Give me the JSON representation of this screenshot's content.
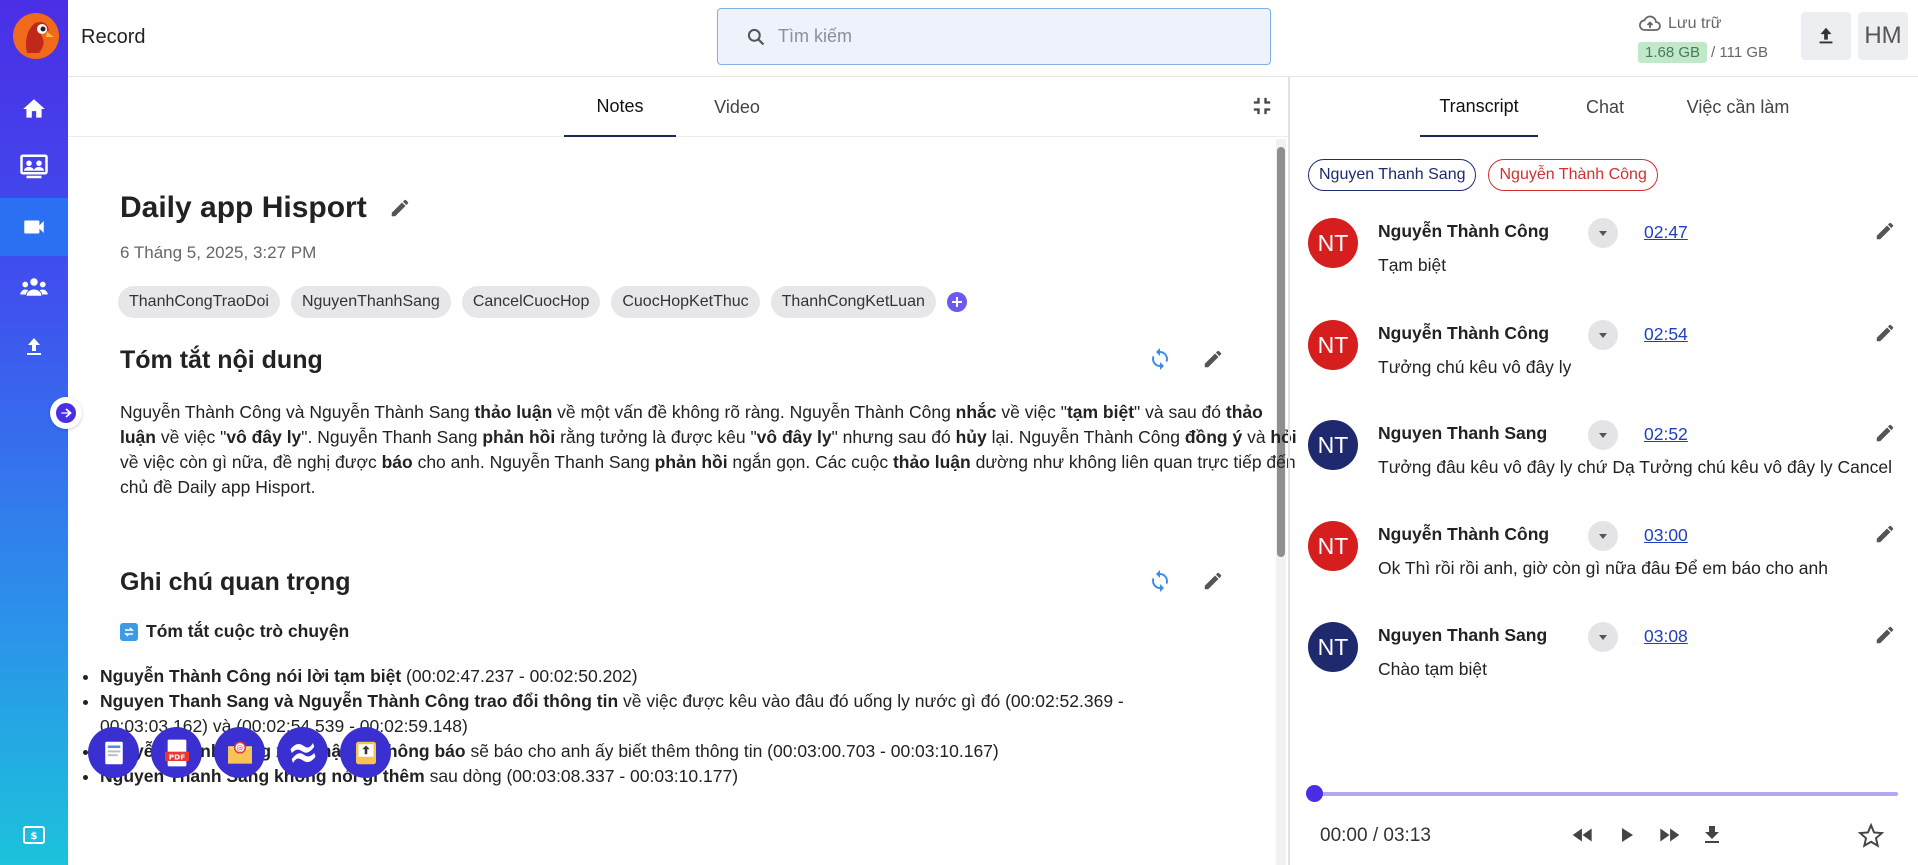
{
  "app": {
    "title": "Record"
  },
  "search": {
    "placeholder": "Tìm kiếm"
  },
  "storage": {
    "label": "Lưu trữ",
    "used": "1.68 GB",
    "total": "/ 111 GB"
  },
  "user": {
    "initials": "HM"
  },
  "left_tabs": [
    {
      "label": "Notes",
      "active": true
    },
    {
      "label": "Video",
      "active": false
    }
  ],
  "note": {
    "title": "Daily app Hisport",
    "date": "6 Tháng 5, 2025, 3:27 PM",
    "tags": [
      "ThanhCongTraoDoi",
      "NguyenThanhSang",
      "CancelCuocHop",
      "CuocHopKetThuc",
      "ThanhCongKetLuan"
    ]
  },
  "summary": {
    "heading": "Tóm tắt nội dung",
    "p1": "Nguyễn Thành Công và Nguyễn Thành Sang ",
    "b1": "thảo luận",
    "p2": " về một vấn đề không rõ ràng. Nguyễn Thành Công ",
    "b2": "nhắc",
    "p3": " về việc \"",
    "b3": "tạm biệt",
    "p4": "\" và sau đó ",
    "b4": "thảo luận",
    "p5": " về việc \"",
    "b5": "vô đây ly",
    "p6": "\". Nguyễn Thanh Sang ",
    "b6": "phản hồi",
    "p7": " rằng tưởng là được kêu \"",
    "b7": "vô đây ly",
    "p8": "\" nhưng sau đó ",
    "b8": "hủy",
    "p9": " lại. Nguyễn Thành Công ",
    "b9": "đồng ý",
    "p10": " và ",
    "b10": "hỏi",
    "p11": " về việc còn gì nữa, đề nghị được ",
    "b11": "báo",
    "p12": " cho anh. Nguyễn Thanh Sang ",
    "b12": "phản hồi",
    "p13": " ngắn gọn. Các cuộc ",
    "b13": "thảo luận",
    "p14": " dường như không liên quan trực tiếp đến chủ đề Daily app Hisport."
  },
  "important": {
    "heading": "Ghi chú quan trọng",
    "subheading": "Tóm tắt cuộc trò chuyện",
    "bullets": [
      {
        "bold": "Nguyễn Thành Công nói lời tạm biệt",
        "rest": " (00:02:47.237 - 00:02:50.202)"
      },
      {
        "bold": "Nguyen Thanh Sang và Nguyễn Thành Công trao đổi thông tin",
        "rest": " về việc được kêu vào đâu đó uống ly nước gì đó (00:02:52.369 - 00:03:03.162) và (00:02:54.539 - 00:02:59.148)"
      },
      {
        "bold": "Nguyễn Thành Công xác nhận và thông báo",
        "rest": " sẽ báo cho anh ấy biết thêm thông tin (00:03:00.703 - 00:03:10.167)"
      },
      {
        "bold": "Nguyen Thanh Sang không nói gì thêm",
        "rest": " sau dòng (00:03:08.337 - 00:03:10.177)"
      }
    ]
  },
  "right_tabs": [
    {
      "label": "Transcript",
      "active": true
    },
    {
      "label": "Chat",
      "active": false
    },
    {
      "label": "Việc cần làm",
      "active": false
    }
  ],
  "speakers": [
    "Nguyen Thanh Sang",
    "Nguyễn Thành Công"
  ],
  "transcript": [
    {
      "initials": "NT",
      "color": "#d61e1e",
      "name": "Nguyễn Thành Công",
      "time": "02:47",
      "text": "Tạm biệt"
    },
    {
      "initials": "NT",
      "color": "#d61e1e",
      "name": "Nguyễn Thành Công",
      "time": "02:54",
      "text": "Tưởng chú kêu vô đây ly"
    },
    {
      "initials": "NT",
      "color": "#1f2a6e",
      "name": "Nguyen Thanh Sang",
      "time": "02:52",
      "text": "Tưởng đâu kêu vô đây ly chứ Dạ Tưởng chú kêu vô đây ly Cancel"
    },
    {
      "initials": "NT",
      "color": "#d61e1e",
      "name": "Nguyễn Thành Công",
      "time": "03:00",
      "text": "Ok Thì rồi rồi anh, giờ còn gì nữa đâu Để em báo cho anh"
    },
    {
      "initials": "NT",
      "color": "#1f2a6e",
      "name": "Nguyen Thanh Sang",
      "time": "03:08",
      "text": "Chào tạm biệt"
    }
  ],
  "player": {
    "time": "00:00 / 03:13",
    "progress": 0.0
  },
  "colors": {
    "accent": "#4a2ee6",
    "link": "#1f3fbf",
    "red": "#d61e1e",
    "navy": "#1f2a6e"
  }
}
